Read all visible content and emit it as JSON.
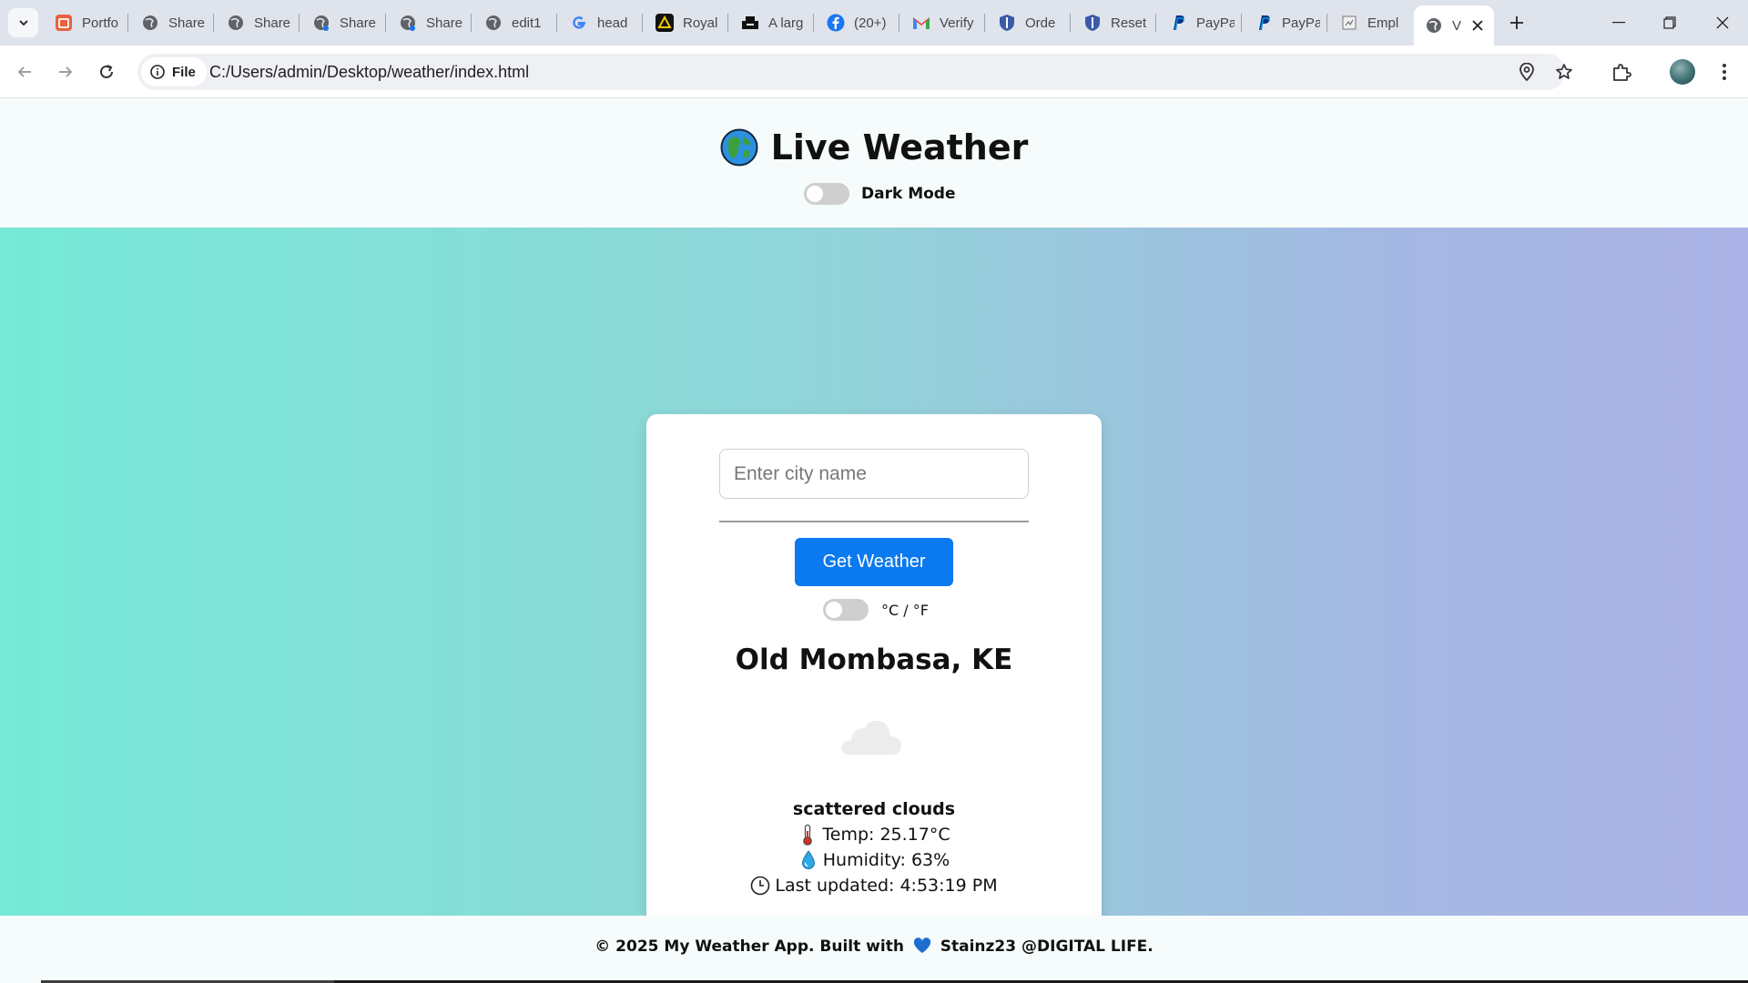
{
  "browser": {
    "tabs": [
      {
        "label": "Portfo",
        "icon": "portfolio-icon"
      },
      {
        "label": "Share",
        "icon": "globe-icon"
      },
      {
        "label": "Share",
        "icon": "globe-icon"
      },
      {
        "label": "Share",
        "icon": "globe-icon"
      },
      {
        "label": "Share",
        "icon": "globe-icon"
      },
      {
        "label": "edit1",
        "icon": "globe-icon"
      },
      {
        "label": "head",
        "icon": "google-icon"
      },
      {
        "label": "Royal",
        "icon": "royal-icon"
      },
      {
        "label": "A larg",
        "icon": "printer-icon"
      },
      {
        "label": "(20+)",
        "icon": "facebook-icon"
      },
      {
        "label": "Verify",
        "icon": "gmail-icon"
      },
      {
        "label": "Orde",
        "icon": "shield-icon"
      },
      {
        "label": "Reset",
        "icon": "shield-icon"
      },
      {
        "label": "PayPa",
        "icon": "paypal-icon"
      },
      {
        "label": "PayPa",
        "icon": "paypal-icon"
      },
      {
        "label": "Empl",
        "icon": "document-icon"
      }
    ],
    "active_tab": {
      "label": "V",
      "icon": "globe-icon"
    },
    "site_chip": "File",
    "url": "C:/Users/admin/Desktop/weather/index.html"
  },
  "app": {
    "title": "Live Weather",
    "dark_mode_label": "Dark Mode",
    "search": {
      "placeholder": "Enter city name",
      "value": ""
    },
    "button_label": "Get Weather",
    "unit_label": "°C / °F",
    "city": "Old Mombasa, KE",
    "description": "scattered clouds",
    "temp": "Temp: 25.17°C",
    "humidity": "Humidity: 63%",
    "updated": "Last updated: 4:53:19 PM",
    "dark_mode_on": false,
    "fahrenheit_on": false
  },
  "footer": {
    "text_before": "© 2025 My Weather App. Built with",
    "text_after": "Stainz23 @DIGITAL LIFE."
  },
  "colors": {
    "button": "#0b79ef",
    "gradient_start": "#76e9d7",
    "gradient_end": "#acb3e6"
  }
}
